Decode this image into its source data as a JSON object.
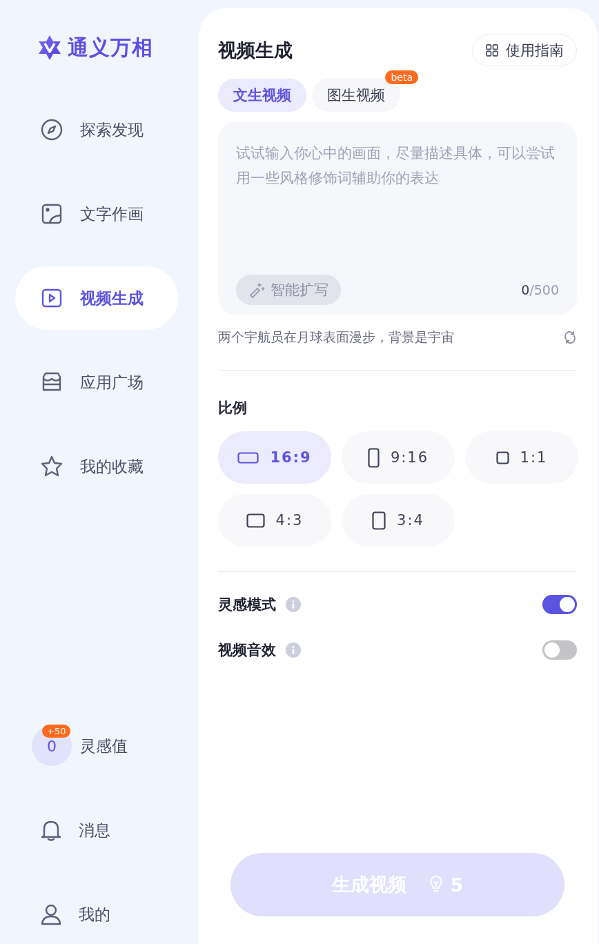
{
  "sidebar": {
    "logo": "通义万相",
    "nav": [
      {
        "label": "探索发现",
        "selected": false
      },
      {
        "label": "文字作画",
        "selected": false
      },
      {
        "label": "视频生成",
        "selected": true
      },
      {
        "label": "应用广场",
        "selected": false
      },
      {
        "label": "我的收藏",
        "selected": false
      }
    ],
    "credits": {
      "value": "0",
      "badge": "+50",
      "label": "灵感值"
    },
    "bottom": [
      {
        "label": "消息"
      },
      {
        "label": "我的"
      }
    ]
  },
  "panel": {
    "title": "视频生成",
    "guide_button": "使用指南",
    "tabs": [
      {
        "label": "文生视频",
        "selected": true
      },
      {
        "label": "图生视频",
        "selected": false,
        "badge": "beta"
      }
    ],
    "prompt": {
      "placeholder": "试试输入你心中的画面，尽量描述具体，可以尝试用一些风格修饰词辅助你的表达",
      "expand_button": "智能扩写",
      "count": "0",
      "limit": "/500"
    },
    "suggestion": "两个宇航员在月球表面漫步，背景是宇宙",
    "ratio_heading": "比例",
    "ratios": [
      {
        "label": "16:9",
        "kind": "landscape",
        "selected": true
      },
      {
        "label": "9:16",
        "kind": "portrait",
        "selected": false
      },
      {
        "label": "1:1",
        "kind": "square",
        "selected": false
      },
      {
        "label": "4:3",
        "kind": "wide",
        "selected": false
      },
      {
        "label": "3:4",
        "kind": "tall",
        "selected": false
      }
    ],
    "toggles": [
      {
        "label": "灵感模式",
        "on": true
      },
      {
        "label": "视频音效",
        "on": false
      }
    ],
    "generate": {
      "label": "生成视频",
      "cost": "5",
      "disabled": true
    }
  }
}
